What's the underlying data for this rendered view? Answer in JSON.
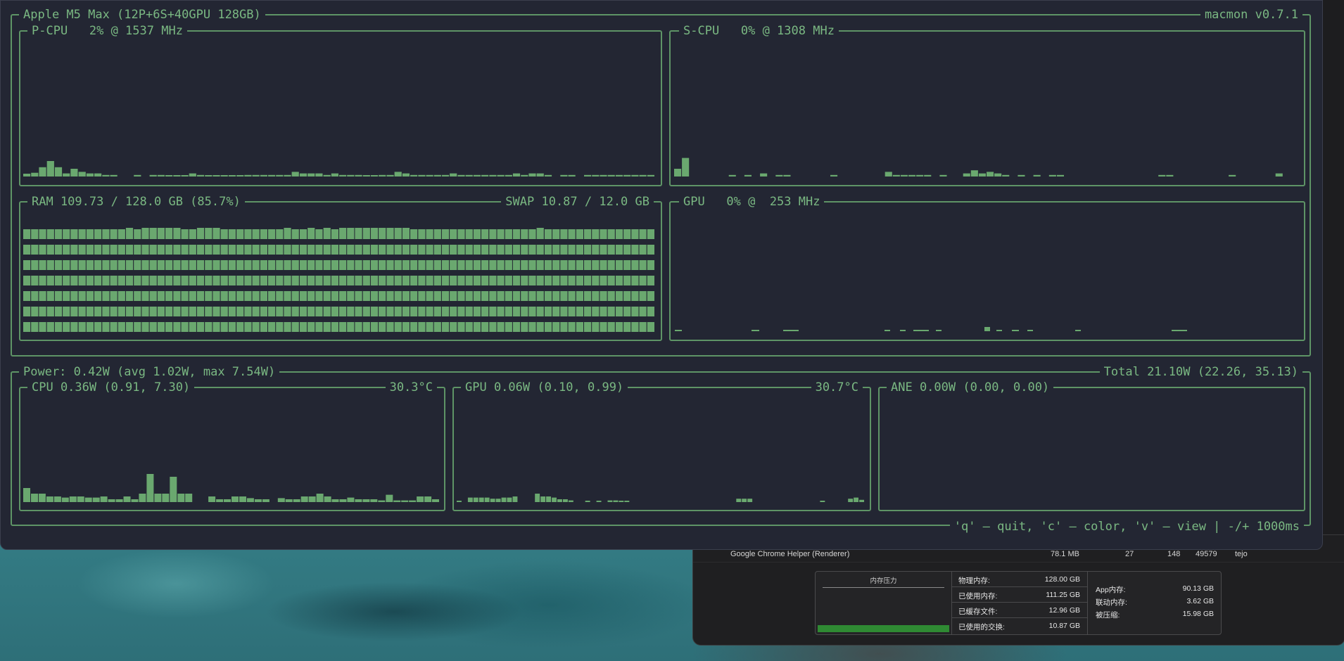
{
  "terminal": {
    "title": "Apple M5 Max (12P+6S+40GPU 128GB)",
    "version": "macmon v0.7.1",
    "footer": "'q' – quit, 'c' – color, 'v' – view | -/+ 1000ms",
    "accent_color": "#7ab882",
    "background_color": "#232633"
  },
  "pcpu": {
    "title": "P-CPU   2% @ 1537 MHz",
    "usage_percent": 2,
    "freq_mhz": 1537,
    "history": [
      0.9,
      1.2,
      3,
      5,
      3,
      1,
      2.5,
      1.5,
      1,
      1,
      0.5,
      0.5,
      0,
      0,
      0.5,
      0,
      0.5,
      0.5,
      0.3,
      0.3,
      0.3,
      1,
      0.5,
      0.3,
      0.3,
      0.3,
      0.3,
      0.3,
      0.5,
      0.5,
      0.5,
      0.5,
      0.5,
      0.5,
      1.5,
      1,
      1,
      1,
      0.5,
      1,
      0.5,
      0.5,
      0.5,
      0.3,
      0.3,
      0.5,
      0.5,
      1.5,
      1,
      0.5,
      0.5,
      0.5,
      0.5,
      0.5,
      1,
      0.5,
      0.5,
      0.5,
      0.5,
      0.5,
      0.5,
      0.5,
      1,
      0.5,
      1,
      1,
      0.5,
      0,
      0.5,
      0.5,
      0,
      0.5,
      0.5,
      0.5,
      0.5,
      0.5,
      0.5,
      0.5,
      0.5,
      0.5
    ]
  },
  "scpu": {
    "title": "S-CPU   0% @ 1308 MHz",
    "usage_percent": 0,
    "freq_mhz": 1308,
    "history": [
      2.5,
      6,
      0,
      0,
      0,
      0,
      0,
      0.5,
      0,
      0.5,
      0,
      1,
      0,
      0.5,
      0.5,
      0,
      0,
      0,
      0,
      0,
      0.5,
      0,
      0,
      0,
      0,
      0,
      0,
      1.5,
      0.5,
      0.5,
      0.5,
      0.5,
      0.5,
      0,
      0.5,
      0,
      0,
      1,
      2,
      1,
      1.5,
      1,
      0.5,
      0,
      0.5,
      0,
      0.5,
      0,
      0.5,
      0.5,
      0,
      0,
      0,
      0,
      0,
      0,
      0,
      0,
      0,
      0,
      0,
      0,
      0.5,
      0.5,
      0,
      0,
      0,
      0,
      0,
      0,
      0,
      0.5,
      0,
      0,
      0,
      0,
      0,
      1,
      0,
      0
    ]
  },
  "ram": {
    "title": "RAM 109.73 / 128.0 GB (85.7%)",
    "swap": "SWAP 10.87 / 12.0 GB",
    "used_percent": 85.7,
    "rows": 7
  },
  "gpu": {
    "title": "GPU   0% @  253 MHz",
    "usage_percent": 0,
    "freq_mhz": 253
  },
  "power": {
    "title": "Power: 0.42W (avg 1.02W, max 7.54W)",
    "total": "Total 21.10W (22.26, 35.13)"
  },
  "cpu_power": {
    "title": "CPU 0.36W (0.91, 7.30)",
    "temp": "30.3°C",
    "history": [
      2.5,
      1.5,
      1.5,
      1,
      1,
      0.8,
      1,
      1,
      0.8,
      0.8,
      1,
      0.5,
      0.5,
      1,
      0.5,
      1.5,
      5,
      1.5,
      1.5,
      4.5,
      1.5,
      1.5,
      0,
      0,
      1,
      0.5,
      0.5,
      1,
      1,
      0.7,
      0.5,
      0.5,
      0,
      0.7,
      0.5,
      0.5,
      1,
      1,
      1.5,
      1,
      0.5,
      0.5,
      0.8,
      0.5,
      0.5,
      0.5,
      0.3,
      1.3,
      0.3,
      0.3,
      0.3,
      1,
      1,
      0.5
    ]
  },
  "gpu_power": {
    "title": "GPU 0.06W (0.10, 0.99)",
    "temp": "30.7°C",
    "history": [
      0.2,
      0,
      0.8,
      0.8,
      0.8,
      0.8,
      0.6,
      0.6,
      0.8,
      0.8,
      1,
      0,
      0,
      0,
      1.5,
      1,
      1,
      0.8,
      0.5,
      0.5,
      0.3,
      0,
      0,
      0.1,
      0,
      0.1,
      0,
      0.3,
      0.3,
      0.1,
      0.1,
      0,
      0,
      0,
      0,
      0,
      0,
      0,
      0,
      0,
      0,
      0,
      0,
      0,
      0,
      0,
      0,
      0,
      0,
      0,
      0.6,
      0.6,
      0.6,
      0,
      0,
      0,
      0,
      0,
      0,
      0,
      0,
      0,
      0,
      0,
      0,
      0.2,
      0,
      0,
      0,
      0,
      0.6,
      0.8,
      0.4
    ]
  },
  "ane_power": {
    "title": "ANE 0.00W (0.00, 0.00)"
  },
  "activity_monitor": {
    "process": {
      "name": "Google Chrome Helper (Renderer)",
      "memory": "78.1 MB",
      "threads": "27",
      "ports": "148",
      "pid": "49579",
      "user": "tejo"
    },
    "memory_pressure_title": "内存压力",
    "stats": [
      {
        "label": "物理内存:",
        "value": "128.00 GB"
      },
      {
        "label": "已使用内存:",
        "value": "111.25 GB"
      },
      {
        "label": "已缓存文件:",
        "value": "12.96 GB"
      },
      {
        "label": "已使用的交换:",
        "value": "10.87 GB"
      }
    ],
    "stats2": [
      {
        "label": "App内存:",
        "value": "90.13 GB"
      },
      {
        "label": "联动内存:",
        "value": "3.62 GB"
      },
      {
        "label": "被压缩:",
        "value": "15.98 GB"
      }
    ]
  }
}
